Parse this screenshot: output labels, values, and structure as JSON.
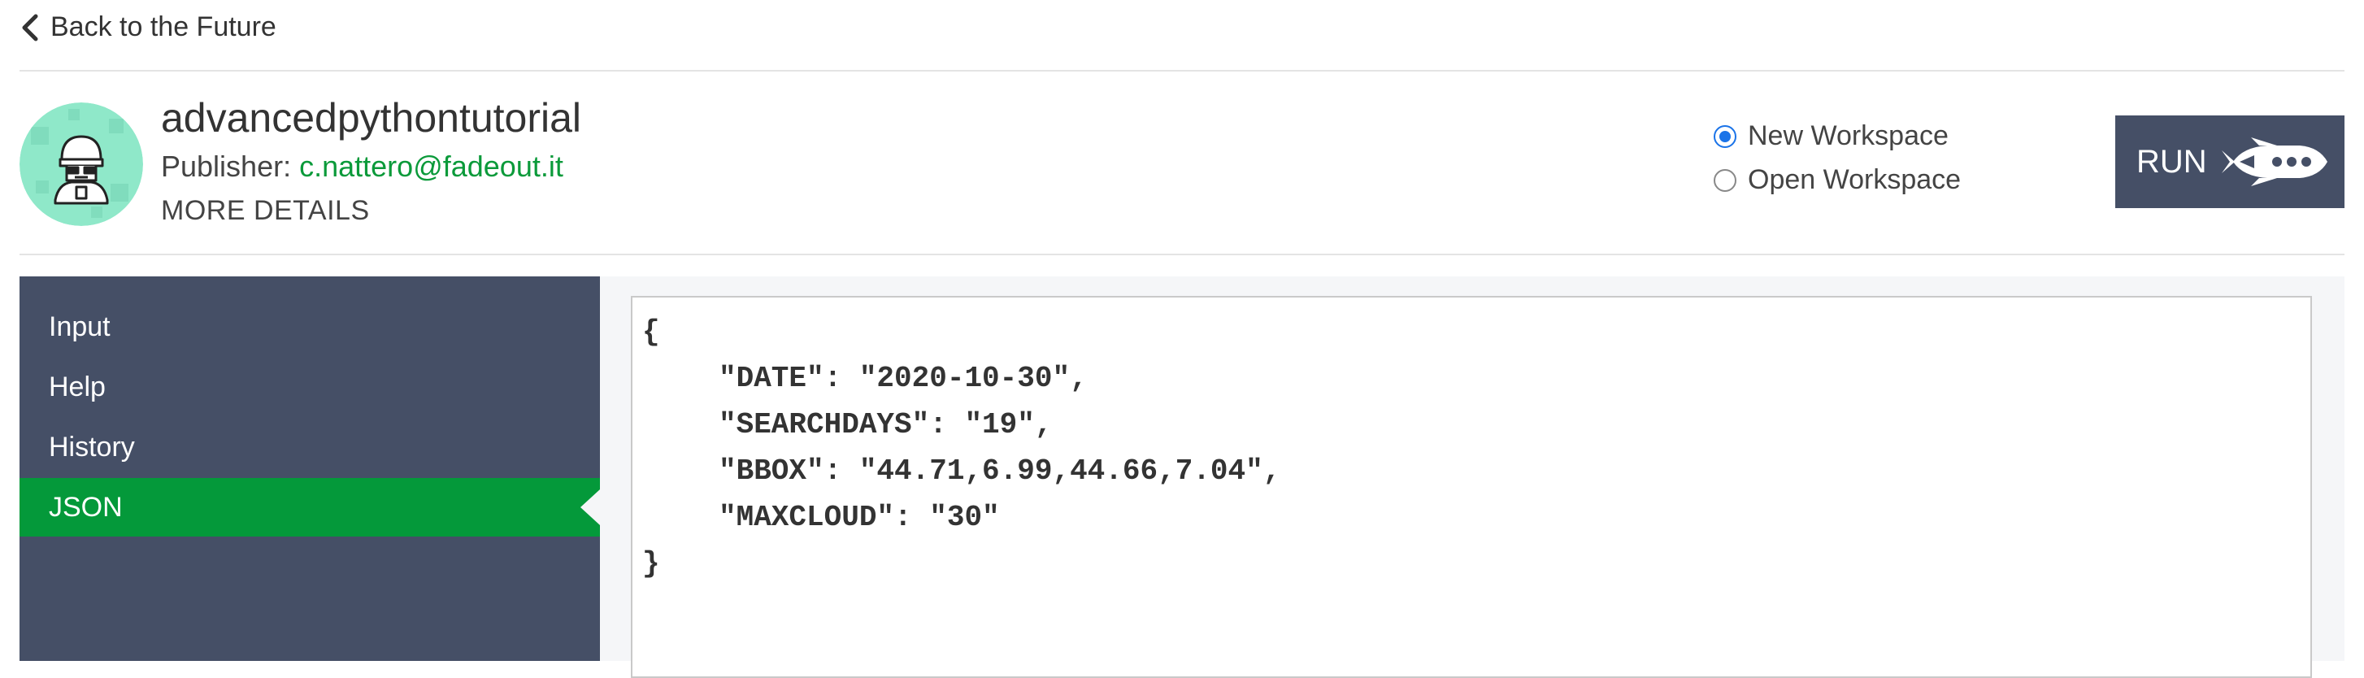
{
  "nav": {
    "back_label": "Back to the Future"
  },
  "app": {
    "title": "advancedpythontutorial",
    "publisher_label": "Publisher:",
    "publisher_email": "c.nattero@fadeout.it",
    "more_details_label": "MORE DETAILS"
  },
  "workspace_options": [
    {
      "label": "New Workspace",
      "selected": true
    },
    {
      "label": "Open Workspace",
      "selected": false
    }
  ],
  "run_button": {
    "label": "RUN"
  },
  "sidebar": {
    "items": [
      {
        "label": "Input",
        "active": false
      },
      {
        "label": "Help",
        "active": false
      },
      {
        "label": "History",
        "active": false
      },
      {
        "label": "JSON",
        "active": true
      }
    ]
  },
  "json_view": {
    "open_brace": "{",
    "lines": [
      "\"DATE\": \"2020-10-30\",",
      "\"SEARCHDAYS\": \"19\",",
      "\"BBOX\": \"44.71,6.99,44.66,7.04\",",
      "\"MAXCLOUD\": \"30\""
    ],
    "close_brace": "}"
  },
  "colors": {
    "sidebar_bg": "#454f66",
    "active_item_bg": "#04993a",
    "link_green": "#0b9a3a",
    "radio_blue": "#1a73e8",
    "avatar_bg": "#8fe8c9"
  }
}
